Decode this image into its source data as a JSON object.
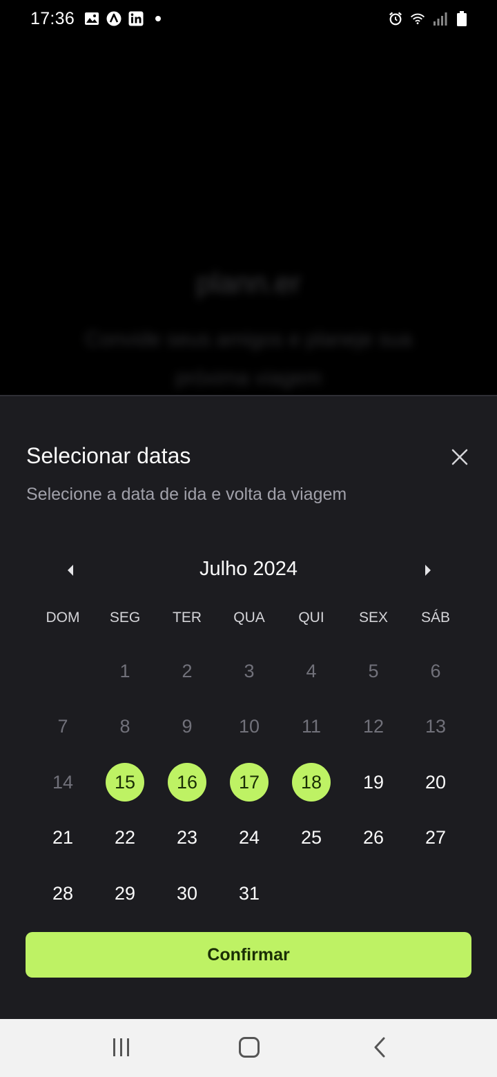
{
  "status_bar": {
    "time": "17:36",
    "left_icons": [
      "image-icon",
      "app-a-icon",
      "linkedin-icon",
      "dot-icon"
    ],
    "right_icons": [
      "alarm-icon",
      "wifi-icon",
      "signal-icon",
      "battery-icon"
    ]
  },
  "background_app": {
    "logo_text": "plann.er",
    "subtitle": "Convide seus amigos e planeje sua próxima viagem"
  },
  "sheet": {
    "title": "Selecionar datas",
    "subtitle": "Selecione a data de ida e volta da viagem",
    "close_icon": "close-icon"
  },
  "calendar": {
    "month_label": "Julho 2024",
    "prev_icon": "caret-left-icon",
    "next_icon": "caret-right-icon",
    "weekdays": [
      "DOM",
      "SEG",
      "TER",
      "QUA",
      "QUI",
      "SEX",
      "SÁB"
    ],
    "first_weekday_offset": 1,
    "days": [
      {
        "d": "1",
        "state": "past"
      },
      {
        "d": "2",
        "state": "past"
      },
      {
        "d": "3",
        "state": "past"
      },
      {
        "d": "4",
        "state": "past"
      },
      {
        "d": "5",
        "state": "past"
      },
      {
        "d": "6",
        "state": "past"
      },
      {
        "d": "7",
        "state": "past"
      },
      {
        "d": "8",
        "state": "past"
      },
      {
        "d": "9",
        "state": "past"
      },
      {
        "d": "10",
        "state": "past"
      },
      {
        "d": "11",
        "state": "past"
      },
      {
        "d": "12",
        "state": "past"
      },
      {
        "d": "13",
        "state": "past"
      },
      {
        "d": "14",
        "state": "past"
      },
      {
        "d": "15",
        "state": "selected"
      },
      {
        "d": "16",
        "state": "selected"
      },
      {
        "d": "17",
        "state": "selected"
      },
      {
        "d": "18",
        "state": "selected"
      },
      {
        "d": "19",
        "state": "future"
      },
      {
        "d": "20",
        "state": "future"
      },
      {
        "d": "21",
        "state": "future"
      },
      {
        "d": "22",
        "state": "future"
      },
      {
        "d": "23",
        "state": "future"
      },
      {
        "d": "24",
        "state": "future"
      },
      {
        "d": "25",
        "state": "future"
      },
      {
        "d": "26",
        "state": "future"
      },
      {
        "d": "27",
        "state": "future"
      },
      {
        "d": "28",
        "state": "future"
      },
      {
        "d": "29",
        "state": "future"
      },
      {
        "d": "30",
        "state": "future"
      },
      {
        "d": "31",
        "state": "future"
      }
    ]
  },
  "confirm_button": {
    "label": "Confirmar"
  },
  "colors": {
    "accent": "#bef264",
    "sheet_bg": "#1c1c20",
    "muted_text": "#71717a",
    "subtitle_text": "#a1a1aa"
  },
  "nav_bar": {
    "recent_icon": "recent-apps-icon",
    "home_icon": "home-icon",
    "back_icon": "back-icon"
  }
}
